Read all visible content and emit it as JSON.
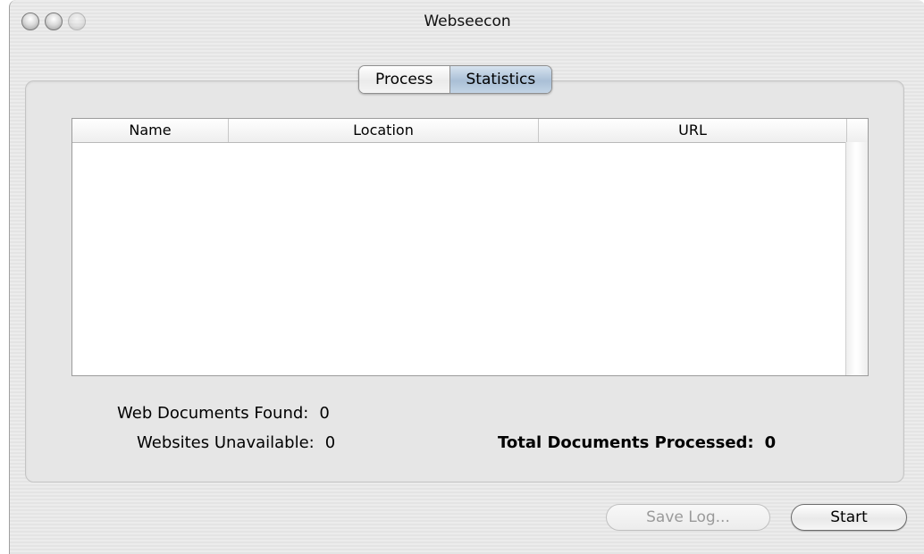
{
  "window": {
    "title": "Webseecon"
  },
  "tabs": [
    {
      "label": "Process",
      "selected": false
    },
    {
      "label": "Statistics",
      "selected": true
    }
  ],
  "table": {
    "columns": [
      "Name",
      "Location",
      "URL"
    ],
    "rows": []
  },
  "stats": {
    "web_documents_found": {
      "label": "Web Documents Found:",
      "value": "0"
    },
    "websites_unavailable": {
      "label": "Websites Unavailable:",
      "value": "0"
    },
    "total_documents_processed": {
      "label": "Total Documents Processed:",
      "value": "0"
    }
  },
  "buttons": {
    "save_log": {
      "label": "Save Log...",
      "enabled": false
    },
    "start": {
      "label": "Start",
      "enabled": true
    }
  },
  "colors": {
    "selected_tab": "#a9bfd6",
    "window_bg": "#ececec",
    "group_bg": "#e6e6e6",
    "disabled_text": "#9a9a9a"
  }
}
